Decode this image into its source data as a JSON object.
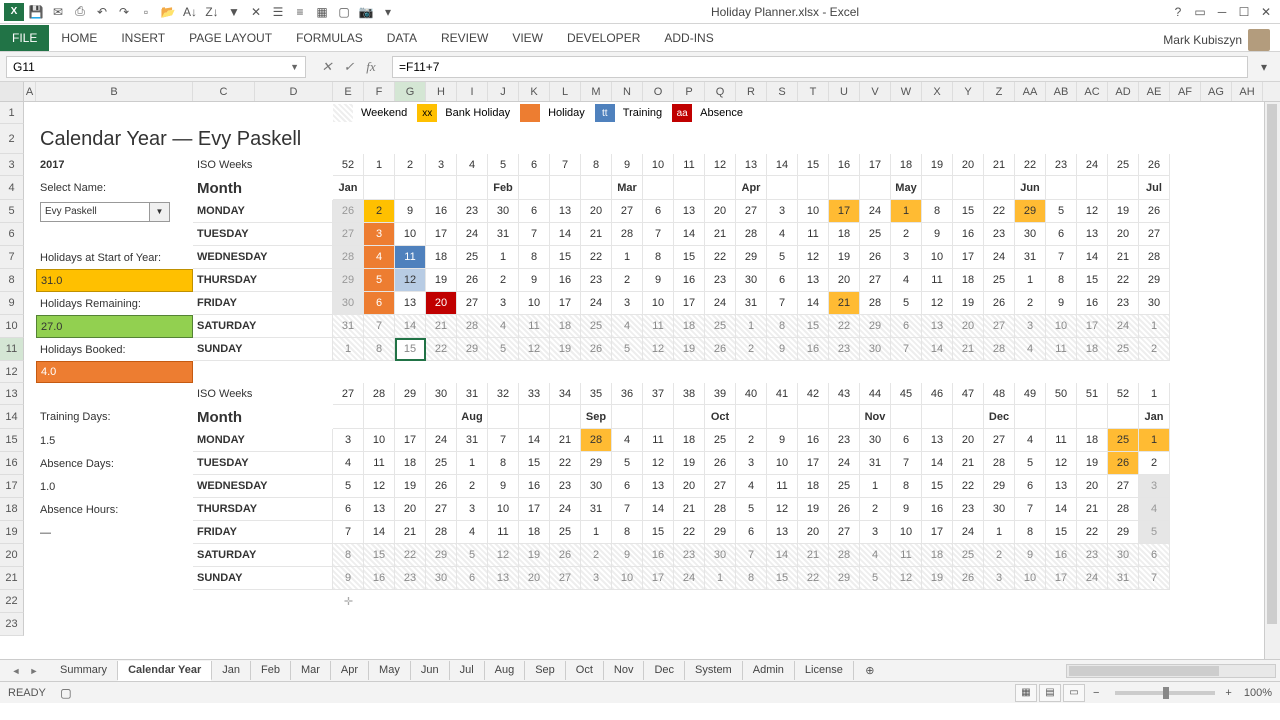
{
  "app": {
    "title": "Holiday Planner.xlsx - Excel",
    "user": "Mark Kubiszyn"
  },
  "ribbon": {
    "file": "FILE",
    "tabs": [
      "HOME",
      "INSERT",
      "PAGE LAYOUT",
      "FORMULAS",
      "DATA",
      "REVIEW",
      "VIEW",
      "DEVELOPER",
      "ADD-INS"
    ]
  },
  "namebox": "G11",
  "formula": "=F11+7",
  "legend": {
    "weekend": "Weekend",
    "bank": "Bank Holiday",
    "bank_sq": "xx",
    "holiday": "Holiday",
    "training": "Training",
    "training_sq": "tt",
    "absence": "Absence",
    "absence_sq": "aa"
  },
  "title": "Calendar Year — Evy Paskell",
  "year": "2017",
  "sidebar": {
    "select_name_lbl": "Select Name:",
    "select_name_val": "Evy Paskell",
    "holidays_start_lbl": "Holidays at Start of Year:",
    "holidays_start_val": "31.0",
    "holidays_remaining_lbl": "Holidays Remaining:",
    "holidays_remaining_val": "27.0",
    "holidays_booked_lbl": "Holidays Booked:",
    "holidays_booked_val": "4.0",
    "training_days_lbl": "Training Days:",
    "training_days_val": "1.5",
    "absence_days_lbl": "Absence Days:",
    "absence_days_val": "1.0",
    "absence_hours_lbl": "Absence Hours:",
    "absence_hours_val": "—"
  },
  "iso_label": "ISO Weeks",
  "month_label": "Month",
  "block1": {
    "iso": [
      "52",
      "1",
      "2",
      "3",
      "4",
      "5",
      "6",
      "7",
      "8",
      "9",
      "10",
      "11",
      "12",
      "13",
      "14",
      "15",
      "16",
      "17",
      "18",
      "19",
      "20",
      "21",
      "22",
      "23",
      "24",
      "25",
      "26"
    ],
    "months": {
      "0": "Jan",
      "5": "Feb",
      "9": "Mar",
      "13": "Apr",
      "18": "May",
      "22": "Jun",
      "26": "Jul"
    },
    "days": [
      "MONDAY",
      "TUESDAY",
      "WEDNESDAY",
      "THURSDAY",
      "FRIDAY",
      "SATURDAY",
      "SUNDAY"
    ],
    "grid": [
      [
        "26",
        "2",
        "9",
        "16",
        "23",
        "30",
        "6",
        "13",
        "20",
        "27",
        "6",
        "13",
        "20",
        "27",
        "3",
        "10",
        "17",
        "24",
        "1",
        "8",
        "15",
        "22",
        "29",
        "5",
        "12",
        "19",
        "26"
      ],
      [
        "27",
        "3",
        "10",
        "17",
        "24",
        "31",
        "7",
        "14",
        "21",
        "28",
        "7",
        "14",
        "21",
        "28",
        "4",
        "11",
        "18",
        "25",
        "2",
        "9",
        "16",
        "23",
        "30",
        "6",
        "13",
        "20",
        "27"
      ],
      [
        "28",
        "4",
        "11",
        "18",
        "25",
        "1",
        "8",
        "15",
        "22",
        "1",
        "8",
        "15",
        "22",
        "29",
        "5",
        "12",
        "19",
        "26",
        "3",
        "10",
        "17",
        "24",
        "31",
        "7",
        "14",
        "21",
        "28"
      ],
      [
        "29",
        "5",
        "12",
        "19",
        "26",
        "2",
        "9",
        "16",
        "23",
        "2",
        "9",
        "16",
        "23",
        "30",
        "6",
        "13",
        "20",
        "27",
        "4",
        "11",
        "18",
        "25",
        "1",
        "8",
        "15",
        "22",
        "29"
      ],
      [
        "30",
        "6",
        "13",
        "20",
        "27",
        "3",
        "10",
        "17",
        "24",
        "3",
        "10",
        "17",
        "24",
        "31",
        "7",
        "14",
        "21",
        "28",
        "5",
        "12",
        "19",
        "26",
        "2",
        "9",
        "16",
        "23",
        "30"
      ],
      [
        "31",
        "7",
        "14",
        "21",
        "28",
        "4",
        "11",
        "18",
        "25",
        "4",
        "11",
        "18",
        "25",
        "1",
        "8",
        "15",
        "22",
        "29",
        "6",
        "13",
        "20",
        "27",
        "3",
        "10",
        "17",
        "24",
        "1"
      ],
      [
        "1",
        "8",
        "15",
        "22",
        "29",
        "5",
        "12",
        "19",
        "26",
        "5",
        "12",
        "19",
        "26",
        "2",
        "9",
        "16",
        "23",
        "30",
        "7",
        "14",
        "21",
        "28",
        "4",
        "11",
        "18",
        "25",
        "2"
      ]
    ],
    "highlights": {
      "grey": [
        [
          0,
          0
        ],
        [
          1,
          0
        ],
        [
          2,
          0
        ],
        [
          3,
          0
        ],
        [
          4,
          0
        ],
        [
          5,
          0
        ]
      ],
      "yellow": [
        [
          0,
          1
        ]
      ],
      "orange": [
        [
          1,
          1
        ],
        [
          2,
          1
        ],
        [
          3,
          1
        ],
        [
          4,
          1
        ]
      ],
      "blue": [
        [
          2,
          2
        ]
      ],
      "lblue": [
        [
          3,
          2
        ]
      ],
      "red": [
        [
          4,
          3
        ]
      ],
      "amber": [
        [
          0,
          16
        ],
        [
          4,
          16
        ],
        [
          0,
          18
        ],
        [
          0,
          22
        ]
      ],
      "hatch_rows": [
        5,
        6
      ],
      "selected": [
        6,
        2
      ]
    }
  },
  "block2": {
    "iso": [
      "27",
      "28",
      "29",
      "30",
      "31",
      "32",
      "33",
      "34",
      "35",
      "36",
      "37",
      "38",
      "39",
      "40",
      "41",
      "42",
      "43",
      "44",
      "45",
      "46",
      "47",
      "48",
      "49",
      "50",
      "51",
      "52",
      "1"
    ],
    "months": {
      "4": "Aug",
      "8": "Sep",
      "12": "Oct",
      "17": "Nov",
      "21": "Dec",
      "26": "Jan"
    },
    "days": [
      "MONDAY",
      "TUESDAY",
      "WEDNESDAY",
      "THURSDAY",
      "FRIDAY",
      "SATURDAY",
      "SUNDAY"
    ],
    "grid": [
      [
        "3",
        "10",
        "17",
        "24",
        "31",
        "7",
        "14",
        "21",
        "28",
        "4",
        "11",
        "18",
        "25",
        "2",
        "9",
        "16",
        "23",
        "30",
        "6",
        "13",
        "20",
        "27",
        "4",
        "11",
        "18",
        "25",
        "1"
      ],
      [
        "4",
        "11",
        "18",
        "25",
        "1",
        "8",
        "15",
        "22",
        "29",
        "5",
        "12",
        "19",
        "26",
        "3",
        "10",
        "17",
        "24",
        "31",
        "7",
        "14",
        "21",
        "28",
        "5",
        "12",
        "19",
        "26",
        "2"
      ],
      [
        "5",
        "12",
        "19",
        "26",
        "2",
        "9",
        "16",
        "23",
        "30",
        "6",
        "13",
        "20",
        "27",
        "4",
        "11",
        "18",
        "25",
        "1",
        "8",
        "15",
        "22",
        "29",
        "6",
        "13",
        "20",
        "27",
        "3"
      ],
      [
        "6",
        "13",
        "20",
        "27",
        "3",
        "10",
        "17",
        "24",
        "31",
        "7",
        "14",
        "21",
        "28",
        "5",
        "12",
        "19",
        "26",
        "2",
        "9",
        "16",
        "23",
        "30",
        "7",
        "14",
        "21",
        "28",
        "4"
      ],
      [
        "7",
        "14",
        "21",
        "28",
        "4",
        "11",
        "18",
        "25",
        "1",
        "8",
        "15",
        "22",
        "29",
        "6",
        "13",
        "20",
        "27",
        "3",
        "10",
        "17",
        "24",
        "1",
        "8",
        "15",
        "22",
        "29",
        "5"
      ],
      [
        "8",
        "15",
        "22",
        "29",
        "5",
        "12",
        "19",
        "26",
        "2",
        "9",
        "16",
        "23",
        "30",
        "7",
        "14",
        "21",
        "28",
        "4",
        "11",
        "18",
        "25",
        "2",
        "9",
        "16",
        "23",
        "30",
        "6"
      ],
      [
        "9",
        "16",
        "23",
        "30",
        "6",
        "13",
        "20",
        "27",
        "3",
        "10",
        "17",
        "24",
        "1",
        "8",
        "15",
        "22",
        "29",
        "5",
        "12",
        "19",
        "26",
        "3",
        "10",
        "17",
        "24",
        "31",
        "7"
      ]
    ],
    "highlights": {
      "amber": [
        [
          0,
          8
        ],
        [
          0,
          25
        ],
        [
          0,
          26
        ],
        [
          1,
          25
        ]
      ],
      "grey_col": 26,
      "hatch_rows": [
        5,
        6
      ]
    }
  },
  "colheads": [
    "A",
    "B",
    "C",
    "D",
    "E",
    "F",
    "G",
    "H",
    "I",
    "J",
    "K",
    "L",
    "M",
    "N",
    "O",
    "P",
    "Q",
    "R",
    "S",
    "T",
    "U",
    "V",
    "W",
    "X",
    "Y",
    "Z",
    "AA",
    "AB",
    "AC",
    "AD",
    "AE",
    "AF",
    "AG",
    "AH"
  ],
  "sheets": [
    "Summary",
    "Calendar Year",
    "Jan",
    "Feb",
    "Mar",
    "Apr",
    "May",
    "Jun",
    "Jul",
    "Aug",
    "Sep",
    "Oct",
    "Nov",
    "Dec",
    "System",
    "Admin",
    "License"
  ],
  "active_sheet": 1,
  "status": "READY",
  "zoom": "100%"
}
